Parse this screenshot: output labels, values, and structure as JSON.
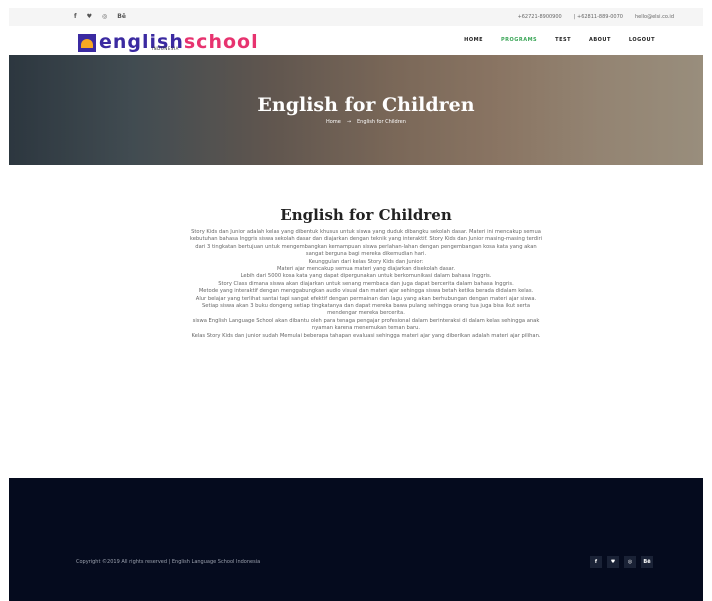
{
  "topbar": {
    "social": [
      "f",
      "♥",
      "◎",
      "Bē"
    ],
    "phone1": "+62721-8900900",
    "phone2": "| +62811-889-0070",
    "email": "hello@elsi.co.id"
  },
  "logo": {
    "part1": "english",
    "part2": "school",
    "sub": "INDONESIA"
  },
  "menu": {
    "home": "HOME",
    "programs": "PROGRAMS",
    "test": "TEST",
    "about": "ABOUT",
    "logout": "LOGOUT"
  },
  "hero": {
    "title": "English for Children",
    "crumb_home": "Home",
    "crumb_sep": "→",
    "crumb_current": "English for Children"
  },
  "content": {
    "title": "English for Children",
    "lines": [
      "Story Kids dan Junior adalah kelas yang dibentuk khusus untuk siswa yang duduk dibangku sekolah dasar. Materi ini mencakup semua kebutuhan bahasa Inggris siswa sekolah dasar dan diajarkan dengan teknik yang interaktif. Story Kids dan Junior masing-masing terdiri dari 3 tingkatan bertujuan untuk mengembangkan kemampuan siswa perlahan-lahan dengan pengembangan kosa kata yang akan sangat berguna bagi mereka dikemudian hari.",
      "Keunggulan dari kelas Story Kids dan Junior:",
      "Materi ajar mencakup semua materi yang diajarkan disekolah dasar.",
      "Lebih dari 5000 kosa kata yang dapat dipergunakan untuk berkomunikasi dalam bahasa Inggris.",
      "Story Class dimana siswa akan diajarkan untuk senang membaca dan juga dapat bercerita dalam bahasa Inggris.",
      "Metode yang interaktif dengan menggabungkan audio visual dan materi ajar sehingga siswa betah ketika berada didalam kelas.",
      "Alur belajar yang terlihat santai tapi sangat efektif dengan permainan dan lagu yang akan berhubungan dengan materi ajar siswa.",
      "Setiap siswa akan 3 buku dongeng setiap tingkatanya dan dapat mereka bawa pulang sehingga orang tua juga bisa ikut serta mendengar mereka bercerita.",
      "siswa English Language School akan dibantu oleh para tenaga pengajar profesional dalam berinteraksi di dalam kelas sehingga anak nyaman karena menemukan teman baru.",
      "Kelas Story Kids dan junior sudah Memulai beberapa tahapan evaluasi sehingga materi ajar yang diberikan adalah materi ajar pilihan."
    ]
  },
  "footer": {
    "copyright": "Copyright ©2019 All rights reserved | English Language School Indonesia",
    "social": [
      "f",
      "♥",
      "◎",
      "Bē"
    ]
  }
}
